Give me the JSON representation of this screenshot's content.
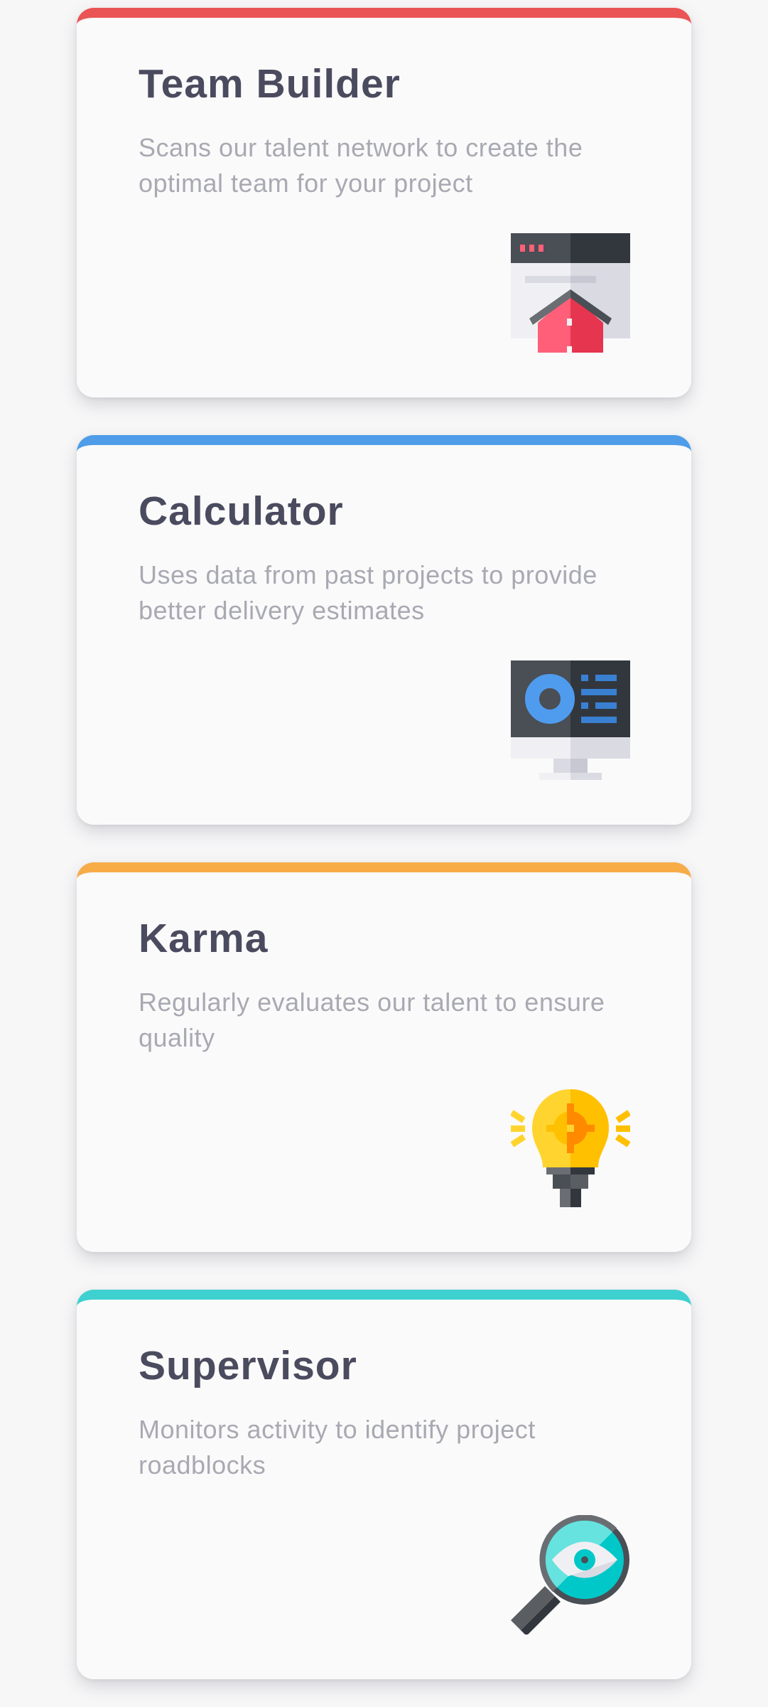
{
  "cards": [
    {
      "title": "Team Builder",
      "description": "Scans our talent network to create the optimal team for your project",
      "accent": "#ea5455",
      "icon": "browser-house-icon"
    },
    {
      "title": "Calculator",
      "description": "Uses data from past projects to provide better delivery estimates",
      "accent": "#4f9ce8",
      "icon": "monitor-dashboard-icon"
    },
    {
      "title": "Karma",
      "description": "Regularly evaluates our talent to ensure quality",
      "accent": "#f8ac48",
      "icon": "lightbulb-gear-icon"
    },
    {
      "title": "Supervisor",
      "description": "Monitors activity to identify project roadblocks",
      "accent": "#3fd0d0",
      "icon": "magnifier-eye-icon"
    }
  ]
}
